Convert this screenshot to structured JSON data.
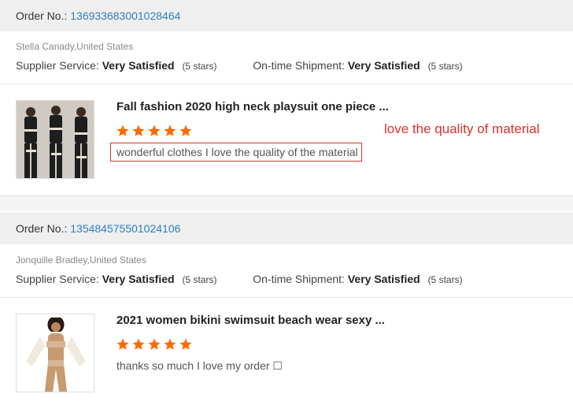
{
  "orders": [
    {
      "order_label": "Order No.:",
      "order_number": "136933683001028464",
      "buyer": "Stella Canady,United States",
      "supplier_label": "Supplier Service:",
      "supplier_value": "Very Satisfied",
      "supplier_stars": "(5 stars)",
      "shipment_label": "On-time Shipment:",
      "shipment_value": "Very Satisfied",
      "shipment_stars": "(5 stars)",
      "product_title": "Fall fashion 2020 high neck playsuit one piece ...",
      "rating": 5,
      "review": "wonderful clothes I love the quality of the material",
      "annotation": "love the quality of material"
    },
    {
      "order_label": "Order No.:",
      "order_number": "135484575501024106",
      "buyer": "Jonquille Bradley,United States",
      "supplier_label": "Supplier Service:",
      "supplier_value": "Very Satisfied",
      "supplier_stars": "(5 stars)",
      "shipment_label": "On-time Shipment:",
      "shipment_value": "Very Satisfied",
      "shipment_stars": "(5 stars)",
      "product_title": "2021 women bikini swimsuit beach wear sexy ...",
      "rating": 5,
      "review": "thanks so much I love my order ☐"
    }
  ],
  "colors": {
    "star": "#ff6a00",
    "link": "#2d7fc1",
    "annotation": "#e0302a"
  }
}
